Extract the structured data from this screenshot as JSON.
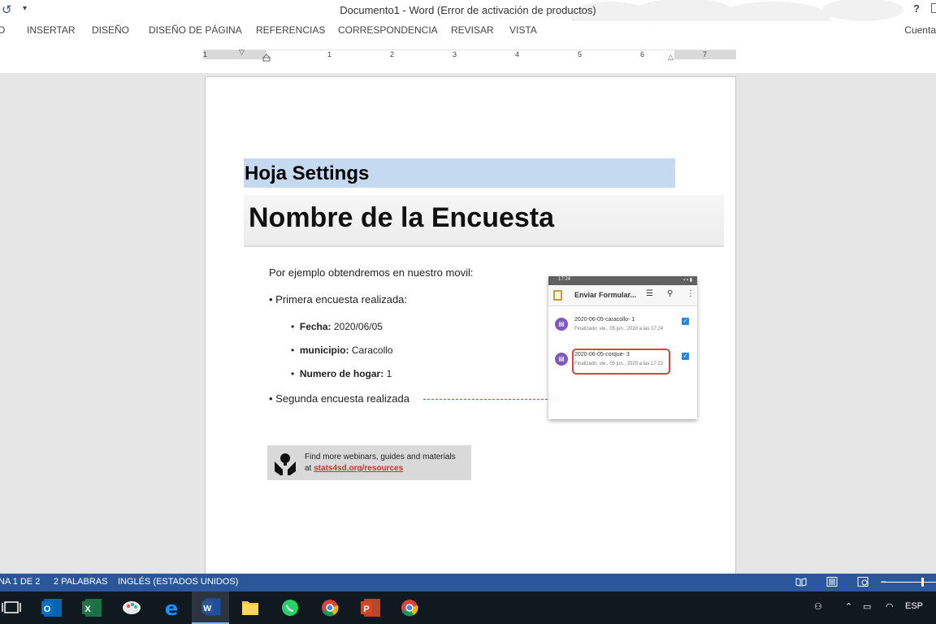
{
  "window": {
    "title": "Documento1 - Word (Error de activación de productos)",
    "help": "?",
    "account": "Cuenta"
  },
  "ribbon": {
    "tabs": [
      "O",
      "INSERTAR",
      "DISEÑO",
      "DISEÑO DE PÁGINA",
      "REFERENCIAS",
      "CORRESPONDENCIA",
      "REVISAR",
      "VISTA"
    ]
  },
  "ruler": {
    "numbers": [
      "1",
      "1",
      "2",
      "3",
      "4",
      "5",
      "6",
      "7"
    ]
  },
  "document": {
    "heading": "Hoja Settings",
    "slide": {
      "title": "Nombre de la Encuesta",
      "intro": "Por ejemplo obtendremos en nuestro movil:",
      "bullet1": "•  Primera encuesta realizada:",
      "sub1_label": "Fecha:",
      "sub1_value": "2020/06/05",
      "sub2_label": "municipio:",
      "sub2_value": "Caracollo",
      "sub3_label": "Numero de hogar:",
      "sub3_value": "1",
      "sub_bullet": "•",
      "bullet2": "•  Segunda encuesta realizada"
    },
    "phone": {
      "status_time": "17:24",
      "app_title": "Enviar Formular...",
      "items": [
        {
          "name": "2020-06-05-caracollo- 1",
          "status": "Finalizado: vie., 05 jun., 2020 a las 17:24"
        },
        {
          "name": "2020-06-05-corque- 3",
          "status": "Finalizado: vie., 05 jun., 2020 a las 17:22"
        }
      ]
    },
    "banner": {
      "line1": "Find more webinars, guides and materials",
      "line2_prefix": "at ",
      "link": "stats4sd.org/resources"
    }
  },
  "statusbar": {
    "page": "NA 1 DE 2",
    "words": "2 PALABRAS",
    "language": "INGLÉS (ESTADOS UNIDOS)"
  },
  "taskbar": {
    "apps": [
      "task-view",
      "outlook",
      "excel",
      "paint",
      "edge",
      "word",
      "file-explorer",
      "whatsapp",
      "chrome",
      "powerpoint",
      "chrome"
    ],
    "active_app": "word",
    "tray_lang": "ESP"
  },
  "colors": {
    "word_blue": "#2b579a",
    "heading_highlight": "#c5d9f1",
    "accent_red": "#d64541"
  }
}
